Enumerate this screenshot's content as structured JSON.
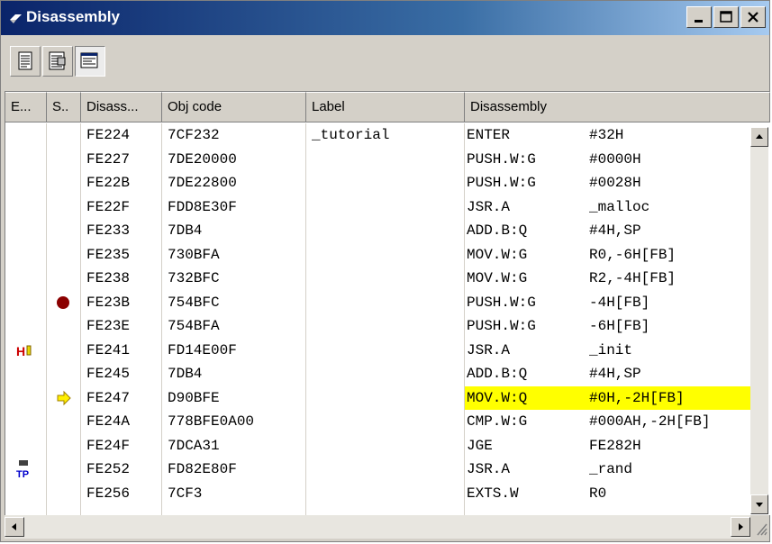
{
  "window": {
    "title": "Disassembly"
  },
  "titlebar": {
    "minimize": "_",
    "maximize": "□",
    "close": "×"
  },
  "toolbar": {
    "tools": [
      "source-view-icon",
      "mixed-view-icon",
      "disassembly-view-icon"
    ]
  },
  "columns": [
    "E...",
    "S..",
    "Disass...",
    "Obj code",
    "Label",
    "Disassembly"
  ],
  "rows": [
    {
      "addr": "FE224",
      "obj": "7CF232",
      "label": "_tutorial",
      "mnem": "ENTER",
      "oper": "#32H",
      "marker": ""
    },
    {
      "addr": "FE227",
      "obj": "7DE20000",
      "label": "",
      "mnem": "PUSH.W:G",
      "oper": "#0000H",
      "marker": ""
    },
    {
      "addr": "FE22B",
      "obj": "7DE22800",
      "label": "",
      "mnem": "PUSH.W:G",
      "oper": "#0028H",
      "marker": ""
    },
    {
      "addr": "FE22F",
      "obj": "FDD8E30F",
      "label": "",
      "mnem": "JSR.A",
      "oper": "_malloc",
      "marker": ""
    },
    {
      "addr": "FE233",
      "obj": "7DB4",
      "label": "",
      "mnem": "ADD.B:Q",
      "oper": "#4H,SP",
      "marker": ""
    },
    {
      "addr": "FE235",
      "obj": "730BFA",
      "label": "",
      "mnem": "MOV.W:G",
      "oper": "R0,-6H[FB]",
      "marker": ""
    },
    {
      "addr": "FE238",
      "obj": "732BFC",
      "label": "",
      "mnem": "MOV.W:G",
      "oper": "R2,-4H[FB]",
      "marker": ""
    },
    {
      "addr": "FE23B",
      "obj": "754BFC",
      "label": "",
      "mnem": "PUSH.W:G",
      "oper": "-4H[FB]",
      "marker": "breakpoint"
    },
    {
      "addr": "FE23E",
      "obj": "754BFA",
      "label": "",
      "mnem": "PUSH.W:G",
      "oper": "-6H[FB]",
      "marker": ""
    },
    {
      "addr": "FE241",
      "obj": "FD14E00F",
      "label": "",
      "mnem": "JSR.A",
      "oper": "_init",
      "marker": "hw-event"
    },
    {
      "addr": "FE245",
      "obj": "7DB4",
      "label": "",
      "mnem": "ADD.B:Q",
      "oper": "#4H,SP",
      "marker": ""
    },
    {
      "addr": "FE247",
      "obj": "D90BFE",
      "label": "",
      "mnem": "MOV.W:Q",
      "oper": "#0H,-2H[FB]",
      "marker": "pc",
      "highlight": true
    },
    {
      "addr": "FE24A",
      "obj": "778BFE0A00",
      "label": "",
      "mnem": "CMP.W:G",
      "oper": "#000AH,-2H[FB]",
      "marker": ""
    },
    {
      "addr": "FE24F",
      "obj": "7DCA31",
      "label": "",
      "mnem": "JGE",
      "oper": "FE282H",
      "marker": ""
    },
    {
      "addr": "FE252",
      "obj": "FD82E80F",
      "label": "",
      "mnem": "JSR.A",
      "oper": "_rand",
      "marker": "trace-point"
    },
    {
      "addr": "FE256",
      "obj": "7CF3",
      "label": "",
      "mnem": "EXTS.W",
      "oper": "R0",
      "marker": ""
    }
  ],
  "event_labels": {
    "hw_event": "H",
    "trace_point": "TP"
  },
  "colors": {
    "highlight": "#ffff00",
    "breakpoint": "#8b0000",
    "pc_arrow": "#e8d800",
    "title_from": "#0a246a",
    "title_to": "#a6caf0"
  }
}
